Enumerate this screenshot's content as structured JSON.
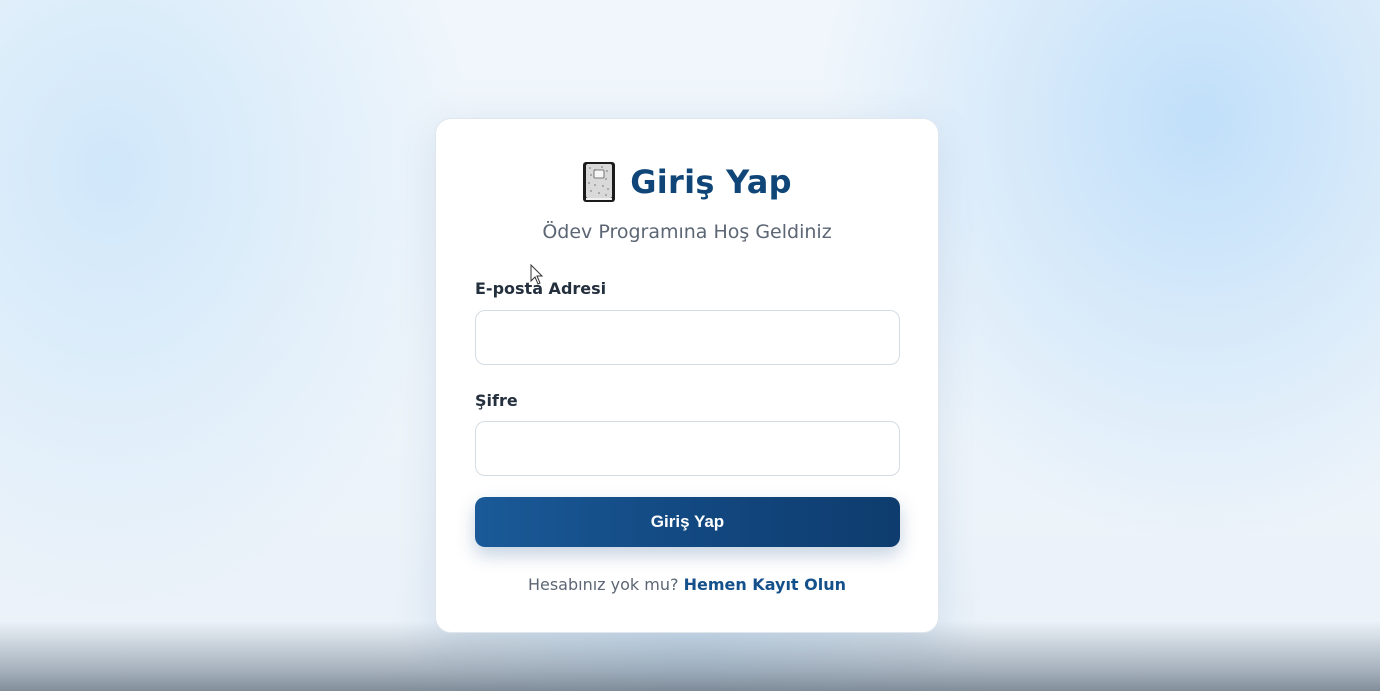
{
  "login": {
    "icon": "notebook-icon",
    "title": "Giriş Yap",
    "subtitle": "Ödev Programına Hoş Geldiniz",
    "email_label": "E-posta Adresi",
    "email_value": "",
    "password_label": "Şifre",
    "password_value": "",
    "submit_label": "Giriş Yap",
    "signup_prompt": "Hesabınız yok mu?",
    "signup_link": "Hemen Kayıt Olun"
  },
  "colors": {
    "primary": "#0f4577",
    "button_start": "#1a5a98",
    "button_end": "#0e3c6e",
    "link": "#14508a"
  }
}
